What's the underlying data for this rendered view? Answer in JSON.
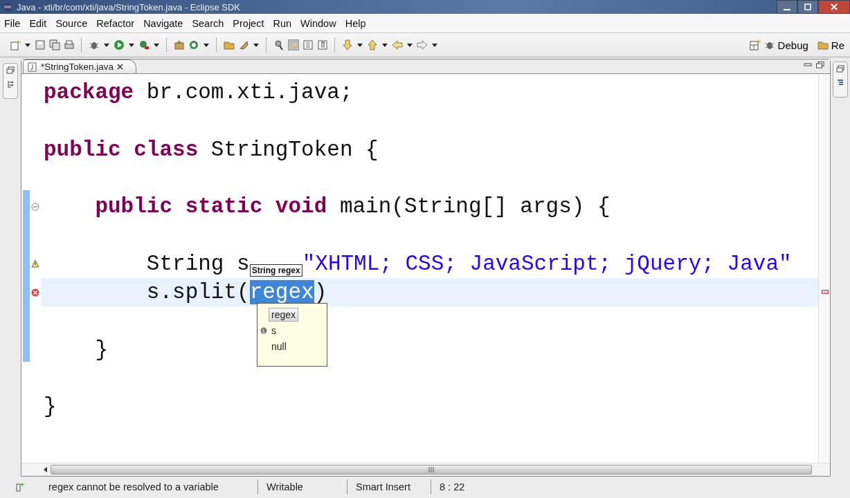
{
  "window": {
    "title": "Java - xti/br/com/xti/java/StringToken.java - Eclipse SDK"
  },
  "menu": [
    "File",
    "Edit",
    "Source",
    "Refactor",
    "Navigate",
    "Search",
    "Project",
    "Run",
    "Window",
    "Help"
  ],
  "perspectives": [
    {
      "label": "Debug",
      "kind": "debug"
    },
    {
      "label": "Re",
      "kind": "resource"
    }
  ],
  "editor": {
    "tabs": [
      {
        "label": "*StringToken.java",
        "selected": true
      }
    ],
    "lines": [
      {
        "kind": "plain",
        "current": false,
        "segments": [
          {
            "kind": "keyword",
            "text": "package"
          },
          {
            "kind": "plain",
            "text": " br.com.xti.java;"
          }
        ]
      },
      {
        "kind": "plain",
        "current": false
      },
      {
        "kind": "plain",
        "current": false,
        "segments": [
          {
            "kind": "keyword",
            "text": "public class"
          },
          {
            "kind": "plain",
            "text": " StringToken {"
          }
        ]
      },
      {
        "kind": "plain",
        "current": false
      },
      {
        "kind": "fold",
        "current": false,
        "segments": [
          {
            "kind": "keyword",
            "text": "    public static void"
          },
          {
            "kind": "plain",
            "text": " main(String[] args) {"
          }
        ]
      },
      {
        "kind": "plain",
        "current": false
      },
      {
        "kind": "warning",
        "current": false,
        "segments": [
          {
            "kind": "plain",
            "text": "        String s"
          },
          {
            "kind": "hint",
            "text": "String regex"
          },
          {
            "kind": "string",
            "text": "\"XHTML; CSS; JavaScript; jQuery; Java\""
          }
        ]
      },
      {
        "kind": "error",
        "current": true,
        "segments": [
          {
            "kind": "plain",
            "text": "        s.split("
          },
          {
            "kind": "selected",
            "text": "regex"
          },
          {
            "kind": "plain",
            "text": ")"
          }
        ]
      },
      {
        "kind": "plain",
        "current": false
      },
      {
        "kind": "plain",
        "current": false,
        "segments": [
          {
            "kind": "plain",
            "text": "    }"
          }
        ]
      },
      {
        "kind": "plain",
        "current": false
      },
      {
        "kind": "plain",
        "current": false,
        "segments": [
          {
            "kind": "plain",
            "text": "}"
          }
        ]
      }
    ]
  },
  "completion": {
    "items": [
      {
        "label": "regex",
        "selected": true,
        "kind": "plain"
      },
      {
        "label": "s",
        "selected": false,
        "kind": "local"
      },
      {
        "label": "null",
        "selected": false,
        "kind": "plain"
      }
    ]
  },
  "status_bar": {
    "message": "regex cannot be resolved to a variable",
    "mode": "Writable",
    "insert": "Smart Insert",
    "position": "8 : 22"
  }
}
